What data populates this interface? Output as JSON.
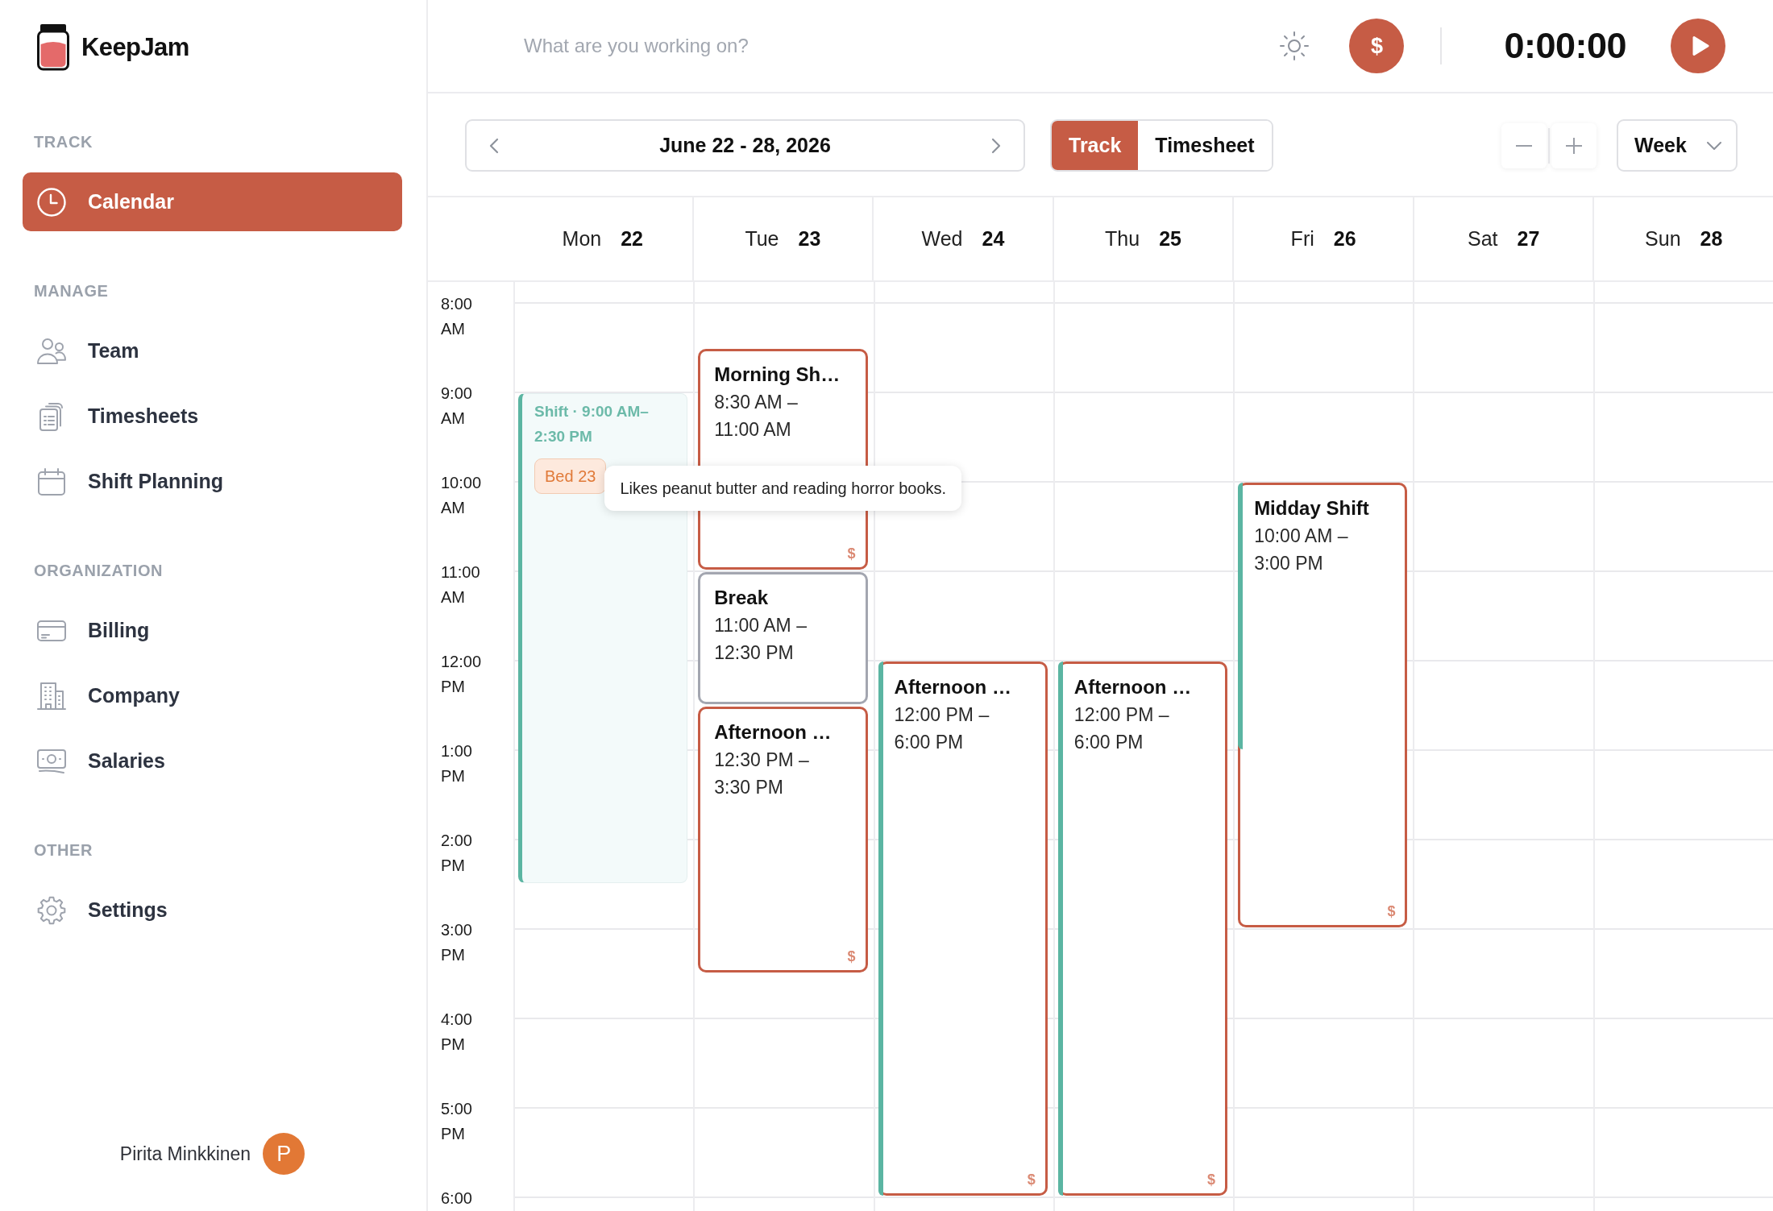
{
  "sidebar": {
    "app_name": "KeepJam",
    "sections": [
      {
        "title": "TRACK",
        "items": [
          {
            "label": "Calendar",
            "selected": true
          }
        ]
      },
      {
        "title": "MANAGE",
        "items": [
          {
            "label": "Team",
            "selected": false
          },
          {
            "label": "Timesheets",
            "selected": false
          },
          {
            "label": "Shift Planning",
            "selected": false
          }
        ]
      },
      {
        "title": "ORGANIZATION",
        "items": [
          {
            "label": "Billing",
            "selected": false
          },
          {
            "label": "Company",
            "selected": false
          },
          {
            "label": "Salaries",
            "selected": false
          }
        ]
      },
      {
        "title": "OTHER",
        "items": [
          {
            "label": "Settings",
            "selected": false
          }
        ]
      }
    ],
    "user": {
      "name": "Pirita Minkkinen",
      "initial": "P"
    }
  },
  "top_bar": {
    "search": {
      "placeholder": "What are you working on?"
    },
    "billable_button": {
      "label": "$"
    },
    "timer": "0:00:00"
  },
  "toolbar": {
    "date_range": "June 22 - 28, 2026",
    "view_tabs": [
      {
        "label": "Track",
        "selected": true
      },
      {
        "label": "Timesheet",
        "selected": false
      }
    ],
    "period_select": {
      "value": "Week"
    }
  },
  "calendar": {
    "hours": [
      "8:00 AM",
      "9:00 AM",
      "10:00 AM",
      "11:00 AM",
      "12:00 PM",
      "1:00 PM",
      "2:00 PM",
      "3:00 PM",
      "4:00 PM",
      "5:00 PM",
      "6:00"
    ],
    "days": [
      {
        "name": "Mon",
        "date": "22",
        "events": [
          {
            "kind": "shift",
            "title": "Shift · 9:00 AM–2:30 PM",
            "tags": [
              {
                "label": "Bed 23",
                "tooltip": "Likes peanut butter and reading horror books."
              }
            ]
          }
        ]
      },
      {
        "name": "Tue",
        "date": "23",
        "events": [
          {
            "kind": "entry",
            "title": "Morning Sh…",
            "time": "8:30 AM – 11:00 AM",
            "badge": "$"
          },
          {
            "kind": "break",
            "title": "Break",
            "time": "11:00 AM – 12:30 PM"
          },
          {
            "kind": "entry",
            "title": "Afternoon …",
            "time": "12:30 PM – 3:30 PM",
            "badge": "$"
          }
        ]
      },
      {
        "name": "Wed",
        "date": "24",
        "events": [
          {
            "kind": "entry",
            "title": "Afternoon …",
            "time": "12:00 PM – 6:00 PM",
            "badge": "$",
            "level": 1
          }
        ]
      },
      {
        "name": "Thu",
        "date": "25",
        "events": [
          {
            "kind": "entry",
            "title": "Afternoon …",
            "time": "12:00 PM – 6:00 PM",
            "badge": "$",
            "level": 1
          }
        ]
      },
      {
        "name": "Fri",
        "date": "26",
        "events": [
          {
            "kind": "entry",
            "title": "Midday Shift",
            "time": "10:00 AM – 3:00 PM",
            "badge": "$",
            "level": 0.6
          }
        ]
      },
      {
        "name": "Sat",
        "date": "27"
      },
      {
        "name": "Sun",
        "date": "28"
      }
    ]
  }
}
